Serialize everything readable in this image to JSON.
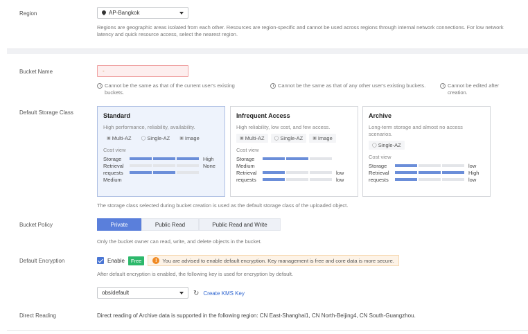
{
  "region": {
    "label": "Region",
    "value": "AP-Bangkok",
    "icon": "location-pin-icon",
    "hint": "Regions are geographic areas isolated from each other. Resources are region-specific and cannot be used across regions through internal network connections. For low network latency and quick resource access, select the nearest region."
  },
  "bucket_name": {
    "label": "Bucket Name",
    "value": "-",
    "rules": [
      "Cannot be the same as that of the current user's existing buckets.",
      "Cannot be the same as that of any other user's existing buckets.",
      "Cannot be edited after creation."
    ]
  },
  "storage_class": {
    "label": "Default Storage Class",
    "cost_view_label": "Cost view",
    "cards": [
      {
        "title": "Standard",
        "desc": "High performance, reliability, availability.",
        "options": [
          "Multi-AZ",
          "Single-AZ",
          "Image"
        ],
        "selected": true,
        "costs": [
          {
            "name": "Storage",
            "level": "High",
            "filled": 3
          },
          {
            "name": "Retrieval",
            "level": "None",
            "filled": 0
          },
          {
            "name": "requests",
            "level": "",
            "filled": 2
          },
          {
            "name": "Medium",
            "level": "",
            "filled": -1
          }
        ]
      },
      {
        "title": "Infrequent Access",
        "desc": "High reliability, low cost, and few access.",
        "options": [
          "Multi-AZ",
          "Single-AZ",
          "Image"
        ],
        "selected": false,
        "costs": [
          {
            "name": "Storage",
            "level": "",
            "filled": 2
          },
          {
            "name": "Medium",
            "level": "",
            "filled": -1
          },
          {
            "name": "Retrieval",
            "level": "low",
            "filled": 1
          },
          {
            "name": "requests",
            "level": "low",
            "filled": 1
          }
        ]
      },
      {
        "title": "Archive",
        "desc": "Long-term storage and almost no access scenarios.",
        "options": [
          "Single-AZ"
        ],
        "selected": false,
        "costs": [
          {
            "name": "Storage",
            "level": "low",
            "filled": 1
          },
          {
            "name": "Retrieval",
            "level": "High",
            "filled": 3
          },
          {
            "name": "requests",
            "level": "low",
            "filled": 1
          }
        ]
      }
    ],
    "hint": "The storage class selected during bucket creation is used as the default storage class of the uploaded object."
  },
  "bucket_policy": {
    "label": "Bucket Policy",
    "options": [
      "Private",
      "Public Read",
      "Public Read and Write"
    ],
    "selected": "Private",
    "hint": "Only the bucket owner can read, write, and delete objects in the bucket."
  },
  "encryption": {
    "label": "Default Encryption",
    "checkbox_label": "Enable",
    "checked": true,
    "badge": "Free",
    "warning": "You are advised to enable default encryption. Key management is free and core data is more secure.",
    "hint": "After default encryption is enabled, the following key is used for encryption by default.",
    "key_value": "obs/default",
    "create_link": "Create KMS Key"
  },
  "direct_reading": {
    "label": "Direct Reading",
    "text": "Direct reading of Archive data is supported in the following region: CN East-Shanghai1, CN North-Beijing4, CN South-Guangzhou."
  },
  "colors": {
    "accent": "#5a7fdb",
    "bar_on": "#6b8ed9",
    "free_badge": "#2db86b",
    "warning": "#f08a24"
  }
}
